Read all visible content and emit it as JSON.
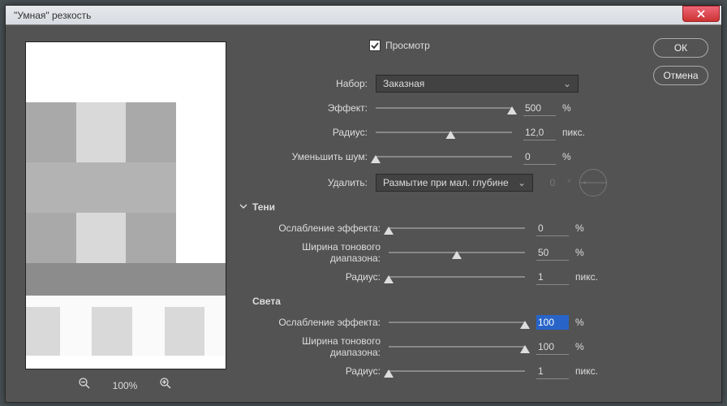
{
  "window": {
    "title": "\"Умная\" резкость"
  },
  "buttons": {
    "ok": "ОК",
    "cancel": "Отмена"
  },
  "preview": {
    "checkbox_label": "Просмотр",
    "zoom": "100%"
  },
  "main": {
    "preset_label": "Набор:",
    "preset_value": "Заказная",
    "amount_label": "Эффект:",
    "amount_value": "500",
    "amount_unit": "%",
    "radius_label": "Радиус:",
    "radius_value": "12,0",
    "radius_unit": "пикс.",
    "noise_label": "Уменьшить шум:",
    "noise_value": "0",
    "noise_unit": "%",
    "remove_label": "Удалить:",
    "remove_value": "Размытие при мал. глубине",
    "angle_value": "0",
    "angle_unit": "°"
  },
  "shadows": {
    "title": "Тени",
    "fade_label": "Ослабление эффекта:",
    "fade_value": "0",
    "fade_unit": "%",
    "width_label": "Ширина тонового диапазона:",
    "width_value": "50",
    "width_unit": "%",
    "radius_label": "Радиус:",
    "radius_value": "1",
    "radius_unit": "пикс."
  },
  "highlights": {
    "title": "Света",
    "fade_label": "Ослабление эффекта:",
    "fade_value": "100",
    "fade_unit": "%",
    "width_label": "Ширина тонового диапазона:",
    "width_value": "100",
    "width_unit": "%",
    "radius_label": "Радиус:",
    "radius_value": "1",
    "radius_unit": "пикс."
  }
}
